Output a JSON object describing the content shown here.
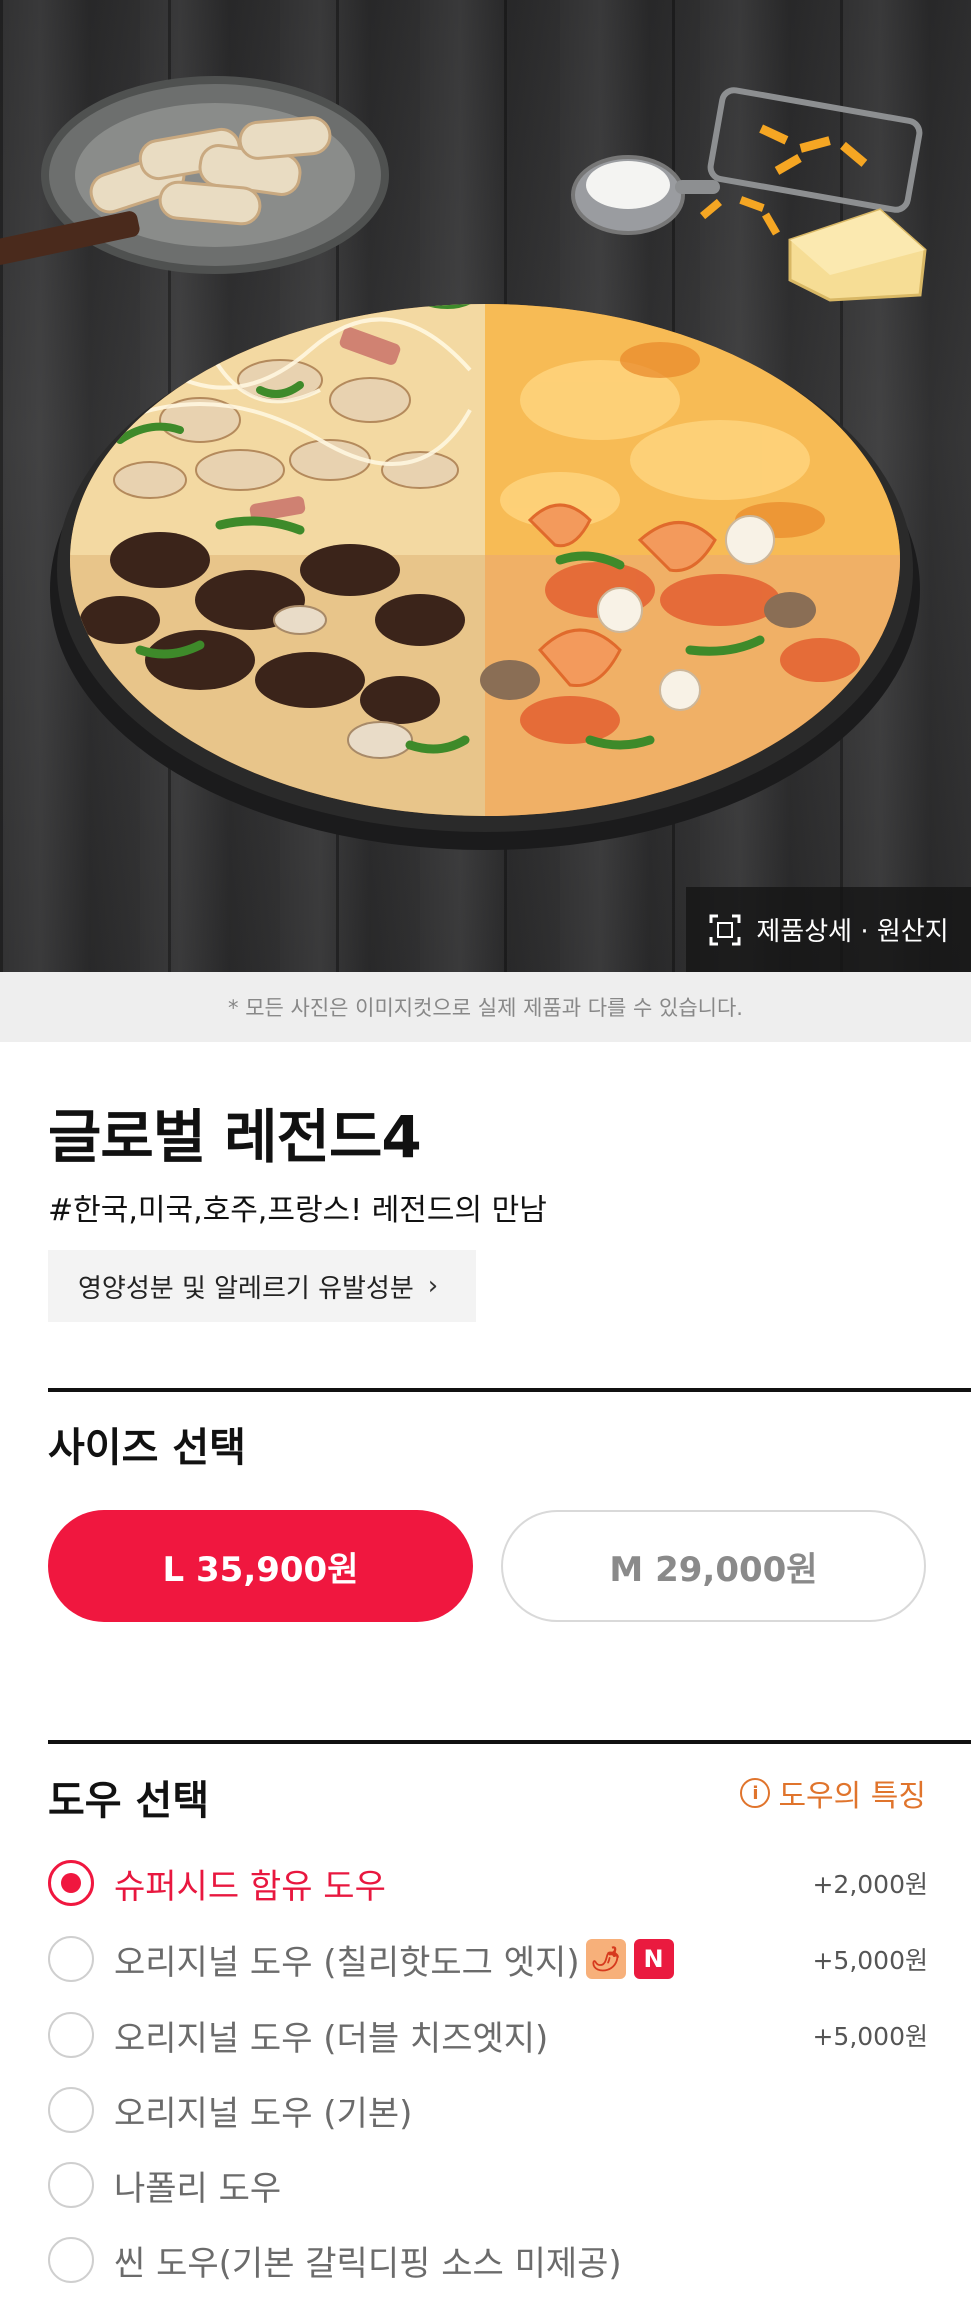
{
  "hero": {
    "detail_button_label": "제품상세 · 원산지"
  },
  "notice": "* 모든 사진은 이미지컷으로 실제 제품과 다를 수 있습니다.",
  "product": {
    "title": "글로벌 레전드4",
    "hashtag": "#한국,미국,호주,프랑스! 레전드의 만남",
    "nutrition_button": "영양성분 및 알레르기 유발성분"
  },
  "size_section": {
    "title": "사이즈 선택",
    "options": [
      {
        "label": "L 35,900원",
        "selected": true
      },
      {
        "label": "M 29,000원",
        "selected": false
      }
    ]
  },
  "dough_section": {
    "title": "도우 선택",
    "info_link": "도우의 특징",
    "options": [
      {
        "label": "슈퍼시드 함유 도우",
        "price": "+2,000원",
        "selected": true
      },
      {
        "label": "오리지널 도우 (칠리핫도그 엣지)",
        "price": "+5,000원",
        "selected": false,
        "badges": [
          "chili-icon",
          "N"
        ]
      },
      {
        "label": "오리지널 도우 (더블 치즈엣지)",
        "price": "+5,000원",
        "selected": false
      },
      {
        "label": "오리지널 도우 (기본)",
        "price": "",
        "selected": false
      },
      {
        "label": "나폴리 도우",
        "price": "",
        "selected": false
      },
      {
        "label": "씬 도우(기본 갈릭디핑 소스 미제공)",
        "price": "",
        "selected": false
      }
    ]
  },
  "colors": {
    "accent": "#f0173f",
    "info": "#e0742c"
  }
}
